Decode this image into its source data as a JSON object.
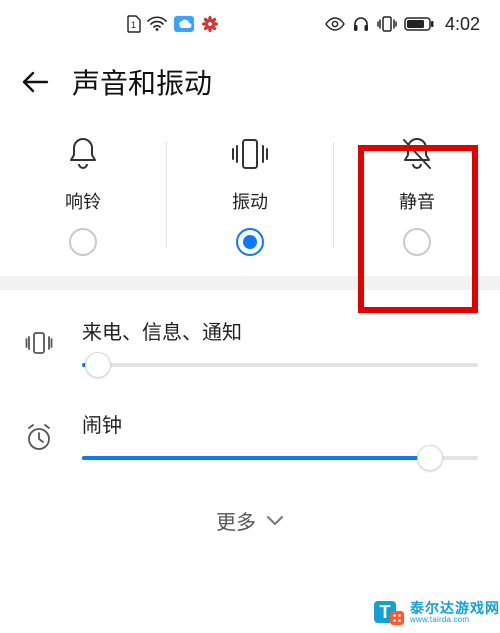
{
  "status": {
    "time": "4:02"
  },
  "header": {
    "title": "声音和振动"
  },
  "modes": {
    "ring": {
      "label": "响铃",
      "selected": false
    },
    "vibrate": {
      "label": "振动",
      "selected": true
    },
    "silent": {
      "label": "静音",
      "selected": false
    }
  },
  "sliders": {
    "notifications": {
      "label": "来电、信息、通知",
      "value": 4
    },
    "alarm": {
      "label": "闹钟",
      "value": 88
    }
  },
  "more": {
    "label": "更多"
  },
  "watermark": {
    "line1": "泰尔达游戏网",
    "line2": "www.tairda.com"
  },
  "colors": {
    "accent": "#0a7af5",
    "highlight": "#e20000",
    "brand": "#14a0d4"
  }
}
